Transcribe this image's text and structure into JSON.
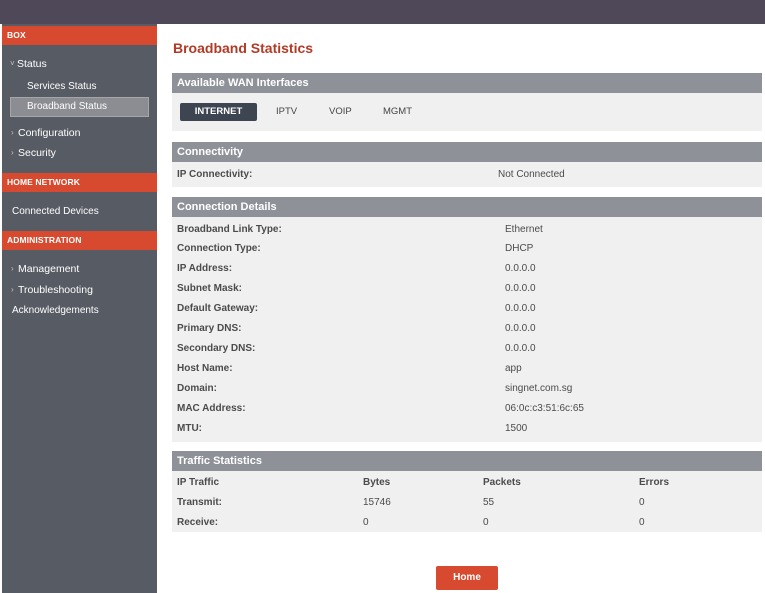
{
  "sidebar": {
    "box_header": "BOX",
    "status": "Status",
    "services_status": "Services Status",
    "broadband_status": "Broadband Status",
    "configuration": "Configuration",
    "security": "Security",
    "home_network_header": "HOME NETWORK",
    "connected_devices": "Connected Devices",
    "administration_header": "ADMINISTRATION",
    "management": "Management",
    "troubleshooting": "Troubleshooting",
    "acknowledgements": "Acknowledgements"
  },
  "page_title": "Broadband Statistics",
  "wan": {
    "header": "Available WAN Interfaces",
    "tabs": [
      "INTERNET",
      "IPTV",
      "VOIP",
      "MGMT"
    ],
    "active_tab": "INTERNET"
  },
  "connectivity": {
    "header": "Connectivity",
    "label": "IP Connectivity:",
    "value": "Not Connected"
  },
  "details": {
    "header": "Connection Details",
    "rows": [
      {
        "label": "Broadband Link Type:",
        "value": "Ethernet"
      },
      {
        "label": "Connection Type:",
        "value": "DHCP"
      },
      {
        "label": "IP Address:",
        "value": "0.0.0.0"
      },
      {
        "label": "Subnet Mask:",
        "value": "0.0.0.0"
      },
      {
        "label": "Default Gateway:",
        "value": "0.0.0.0"
      },
      {
        "label": "Primary DNS:",
        "value": "0.0.0.0"
      },
      {
        "label": "Secondary DNS:",
        "value": "0.0.0.0"
      },
      {
        "label": "Host Name:",
        "value": "app"
      },
      {
        "label": "Domain:",
        "value": "singnet.com.sg"
      },
      {
        "label": "MAC Address:",
        "value": "06:0c:c3:51:6c:65"
      },
      {
        "label": "MTU:",
        "value": "1500"
      }
    ]
  },
  "traffic": {
    "header": "Traffic Statistics",
    "columns": [
      "IP Traffic",
      "Bytes",
      "Packets",
      "Errors"
    ],
    "rows": [
      [
        "Transmit:",
        "15746",
        "55",
        "0"
      ],
      [
        "Receive:",
        "0",
        "0",
        "0"
      ]
    ]
  },
  "home_button": "Home",
  "colors": {
    "accent": "#d84a2f",
    "title": "#b23a26",
    "sidebar": "#575b63",
    "panel_header": "#8f9199",
    "topbar": "#4f4859"
  }
}
